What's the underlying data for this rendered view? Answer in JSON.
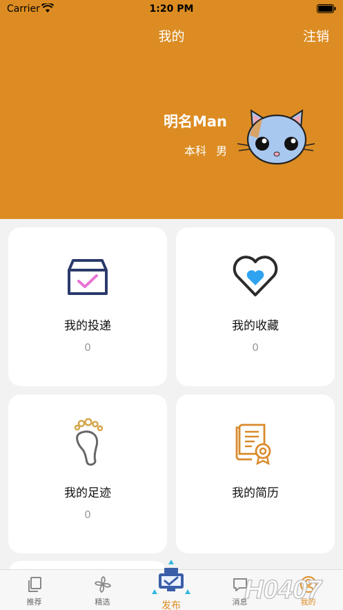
{
  "status_bar": {
    "carrier": "Carrier",
    "time": "1:20 PM"
  },
  "nav": {
    "title": "我的",
    "logout_label": "注销"
  },
  "profile": {
    "name": "明名Man",
    "degree": "本科",
    "gender": "男",
    "avatar_icon": "cat-avatar-icon"
  },
  "cards": [
    {
      "title": "我的投递",
      "count": "0",
      "icon": "inbox-check-icon"
    },
    {
      "title": "我的收藏",
      "count": "0",
      "icon": "heart-icon"
    },
    {
      "title": "我的足迹",
      "count": "0",
      "icon": "footprint-icon"
    },
    {
      "title": "我的简历",
      "count": "",
      "icon": "resume-certificate-icon"
    }
  ],
  "tabbar": {
    "tabs": [
      {
        "label": "推荐",
        "icon": "copy-pages-icon"
      },
      {
        "label": "精选",
        "icon": "flower-emblem-icon"
      },
      {
        "label": "发布",
        "icon": "publish-icon"
      },
      {
        "label": "消息",
        "icon": "message-icon"
      },
      {
        "label": "我的",
        "icon": "profile-icon"
      }
    ]
  },
  "colors": {
    "brand_orange": "#dc8c22",
    "card_background": "#ffffff",
    "page_background": "#f2f2f2",
    "inbox_blue": "#2b3a6b",
    "check_pink": "#e873d5",
    "heart_blue": "#2fa3f0",
    "foot_gold": "#d4a64a"
  },
  "watermark": {
    "text": "H0407"
  }
}
